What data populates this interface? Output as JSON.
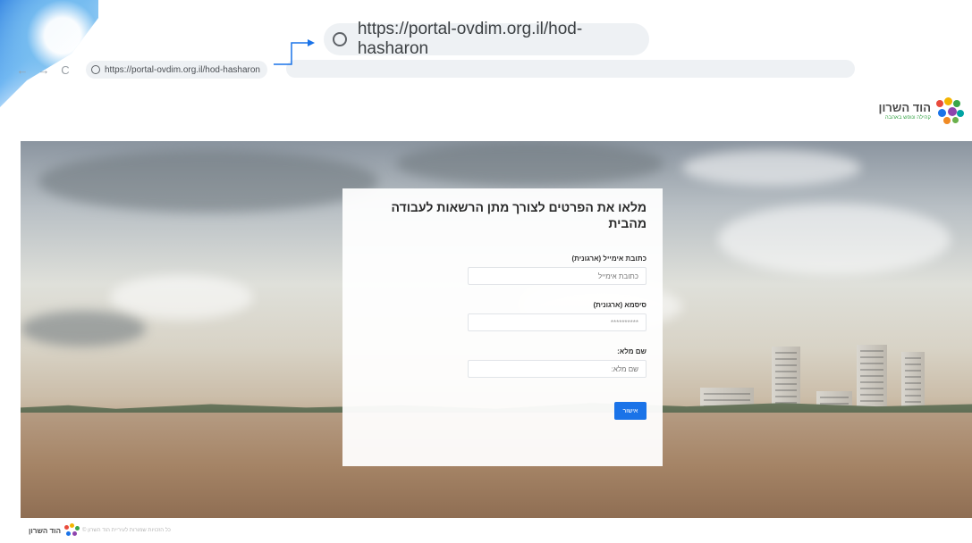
{
  "browser": {
    "url": "https://portal-ovdim.org.il/hod-hasharon",
    "zoomed_url": "https://portal-ovdim.org.il/hod-hasharon",
    "back_icon": "back-arrow-icon",
    "forward_icon": "forward-arrow-icon",
    "reload_icon": "reload-icon",
    "site_icon": "globe-icon"
  },
  "header": {
    "logo_title": "הוד השרון",
    "logo_subtitle": "קהילה ונופש באהבה"
  },
  "form": {
    "title": "מלאו את הפרטים לצורך מתן הרשאות לעבודה מהבית",
    "email_label": "כתובת אימייל (ארגונית)",
    "email_placeholder": "כתובת אימייל",
    "password_label": "סיסמא (ארגונית)",
    "password_value": "**********",
    "fullname_label": "שם מלא:",
    "fullname_placeholder": "שם מלא:",
    "submit_label": "אישור"
  },
  "footer": {
    "logo_title": "הוד השרון",
    "copyright": "כל הזכויות שמורות לעיריית הוד השרון ©"
  },
  "colors": {
    "accent": "#1a73e8",
    "logo_green": "#3aa64a"
  }
}
